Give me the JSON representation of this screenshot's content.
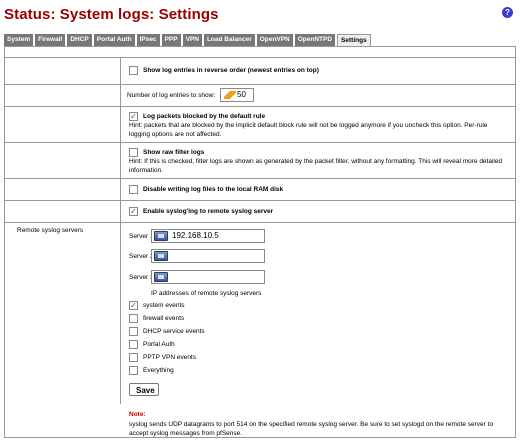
{
  "page_title": "Status: System logs: Settings",
  "help_icon_glyph": "?",
  "tabs": [
    {
      "label": "System",
      "active": false
    },
    {
      "label": "Firewall",
      "active": false
    },
    {
      "label": "DHCP",
      "active": false
    },
    {
      "label": "Portal Auth",
      "active": false
    },
    {
      "label": "IPsec",
      "active": false
    },
    {
      "label": "PPP",
      "active": false
    },
    {
      "label": "VPN",
      "active": false
    },
    {
      "label": "Load Balancer",
      "active": false
    },
    {
      "label": "OpenVPN",
      "active": false
    },
    {
      "label": "OpenNTPD",
      "active": false
    },
    {
      "label": "Settings",
      "active": true
    }
  ],
  "options": {
    "reverse": {
      "checked": false,
      "label": "Show log entries in reverse order (newest entries on top)"
    },
    "num_entries": {
      "label": "Number of log entries to show:",
      "value": "50"
    },
    "block_default": {
      "checked": true,
      "label": "Log packets blocked by the default rule",
      "hint": "Hint: packets that are blocked by the implicit default block rule will not be logged anymore if you uncheck this option. Per-rule logging options are not affected."
    },
    "raw_filter": {
      "checked": false,
      "label": "Show raw filter logs",
      "hint": "Hint: If this is checked, filter logs are shown as generated by the packet filter, without any formatting. This will reveal more detailed information."
    },
    "disable_ramdisk": {
      "checked": false,
      "label": "Disable writing log files to the local RAM disk"
    },
    "enable_syslog": {
      "checked": true,
      "label": "Enable syslog'ing to remote syslog server"
    }
  },
  "remote": {
    "section_label": "Remote syslog servers",
    "server1_label": "Server 1",
    "server1_value": "192.168.10.5",
    "server2_label": "Server 2",
    "server2_value": "",
    "server3_label": "Server 3",
    "server3_value": "",
    "ip_hint": "IP addresses of remote syslog servers",
    "events": [
      {
        "label": "system events",
        "checked": true
      },
      {
        "label": "firewall events",
        "checked": false
      },
      {
        "label": "DHCP service events",
        "checked": false
      },
      {
        "label": "Portal Auth",
        "checked": false
      },
      {
        "label": "PPTP VPN events",
        "checked": false
      },
      {
        "label": "Everything",
        "checked": false
      }
    ]
  },
  "save_label": "Save",
  "note": {
    "label": "Note:",
    "text": "syslog sends UDP datagrams to port 514 on the specified remote syslog server. Be sure to set syslogd on the remote server to accept syslog messages from pfSense."
  },
  "colors": {
    "title": "#990000",
    "tab_bg": "#77777a",
    "note_label": "#cc0000"
  }
}
